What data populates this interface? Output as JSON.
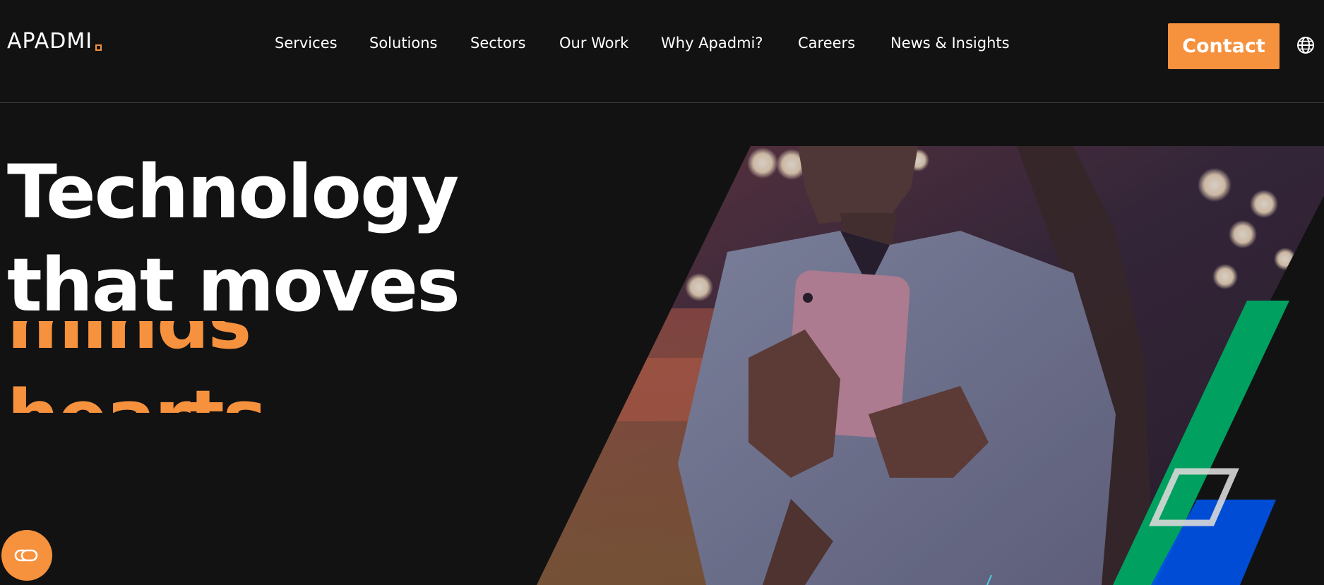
{
  "brand": {
    "logo_text": "APADMI",
    "accent_color": "#f6913e",
    "background_color": "#121212"
  },
  "nav": {
    "items": [
      {
        "label": "Services"
      },
      {
        "label": "Solutions"
      },
      {
        "label": "Sectors"
      },
      {
        "label": "Our Work"
      },
      {
        "label": "Why Apadmi?"
      },
      {
        "label": "Careers"
      },
      {
        "label": "News & Insights"
      }
    ],
    "contact_label": "Contact",
    "language_icon": "globe-icon"
  },
  "hero": {
    "headline_line1": "Technology",
    "headline_line2": "that moves",
    "rotating_words": [
      "minds",
      "hearts"
    ],
    "rotating_color": "#f6913e",
    "image_icon": "woman-using-smartphone-photo"
  },
  "decorations": {
    "green_color": "#00a060",
    "blue_color": "#0050e0",
    "outline_color": "#d8d8d8"
  },
  "chat": {
    "icon": "chat-link-icon"
  }
}
